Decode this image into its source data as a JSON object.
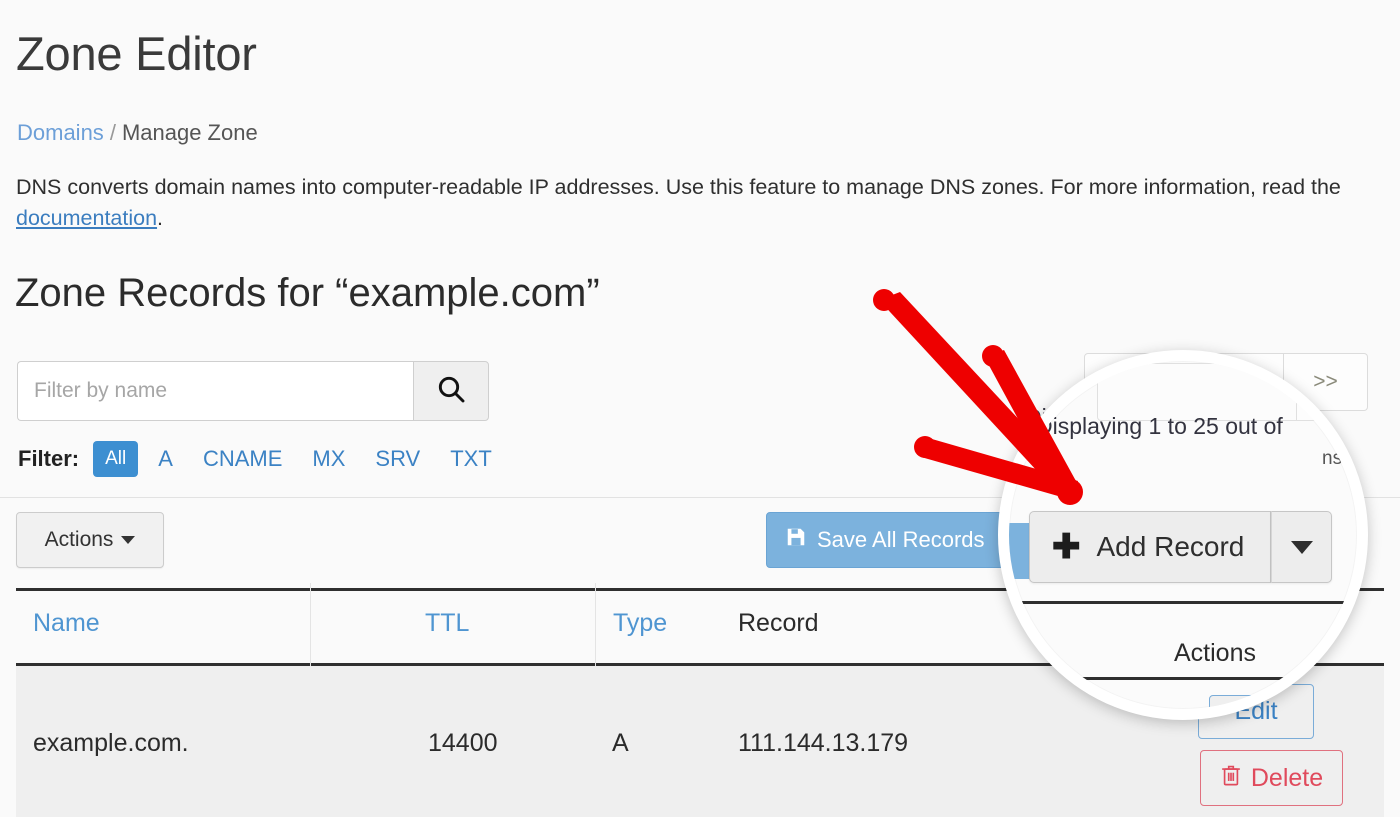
{
  "header": {
    "title": "Zone Editor",
    "breadcrumb": {
      "root": "Domains",
      "separator": "/",
      "current": "Manage Zone"
    },
    "intro_text_part1": "DNS converts domain names into computer-readable IP addresses. Use this feature to manage DNS zones. For more information, read the ",
    "intro_link": "documentation",
    "intro_text_part2": "."
  },
  "records_section": {
    "title": "Zone Records for “example.com”"
  },
  "search": {
    "placeholder": "Filter by name",
    "value": "",
    "button_icon": "search-icon"
  },
  "filter": {
    "label": "Filter:",
    "chips": [
      {
        "label": "All",
        "active": true
      },
      {
        "label": "A",
        "active": false
      },
      {
        "label": "CNAME",
        "active": false
      },
      {
        "label": "MX",
        "active": false
      },
      {
        "label": "SRV",
        "active": false
      },
      {
        "label": "TXT",
        "active": false
      }
    ]
  },
  "toolbar": {
    "actions_label": "Actions",
    "save_label": "Save All Records",
    "save_icon": "floppy-disk-icon",
    "add_record_label": "Add Record",
    "add_record_icon": "plus-icon",
    "add_record_caret_icon": "chevron-down-icon"
  },
  "pagination": {
    "page_value": "",
    "next_label": ">>",
    "info": "Displaying 1 to 25 out of",
    "info_tail": "ns"
  },
  "table": {
    "columns": [
      "Name",
      "TTL",
      "Type",
      "Record",
      "Actions"
    ],
    "rows": [
      {
        "name": "example.com.",
        "ttl": "14400",
        "type": "A",
        "record": "111.144.13.179",
        "edit_label": "Edit",
        "delete_label": "Delete",
        "delete_icon": "trash-icon"
      }
    ]
  },
  "annotation": {
    "arrow_color": "#ee0000",
    "magnifier_ring_color": "#ffffff",
    "magnifier_label": "zoom-callout-add-record"
  },
  "colors": {
    "accent_blue": "#3d8fd1",
    "link_blue": "#3b82c4",
    "save_button_blue": "#7cb2dd",
    "danger_red": "#e04a5c",
    "page_background": "#fafafa",
    "row_background": "#efefef"
  }
}
